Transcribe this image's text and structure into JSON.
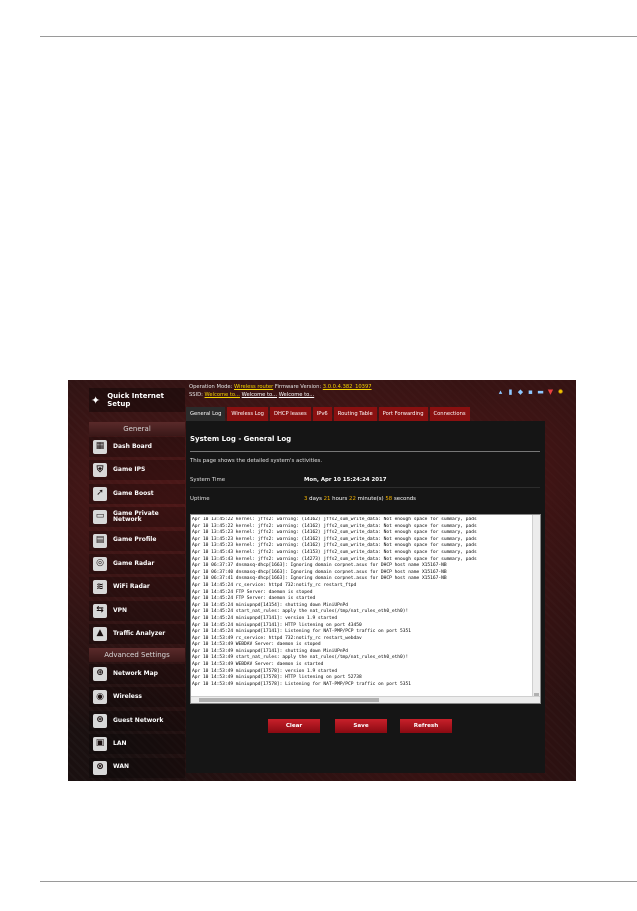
{
  "sidebar": {
    "quick_setup": "Quick Internet Setup",
    "general_heading": "General",
    "general_items": [
      {
        "label": "Dash Board",
        "icon": "dashboard-icon"
      },
      {
        "label": "Game IPS",
        "icon": "shield-icon"
      },
      {
        "label": "Game Boost",
        "icon": "rocket-icon"
      },
      {
        "label": "Game Private Network",
        "icon": "private-network-icon"
      },
      {
        "label": "Game Profile",
        "icon": "gamepad-icon"
      },
      {
        "label": "Game Radar",
        "icon": "radar-icon"
      },
      {
        "label": "WiFi Radar",
        "icon": "wifi-radar-icon"
      },
      {
        "label": "VPN",
        "icon": "vpn-icon"
      },
      {
        "label": "Traffic Analyzer",
        "icon": "traffic-analyzer-icon"
      }
    ],
    "advanced_heading": "Advanced Settings",
    "advanced_items": [
      {
        "label": "Network Map",
        "icon": "network-map-icon"
      },
      {
        "label": "Wireless",
        "icon": "wireless-icon"
      },
      {
        "label": "Guest Network",
        "icon": "guest-network-icon"
      },
      {
        "label": "LAN",
        "icon": "lan-icon"
      },
      {
        "label": "WAN",
        "icon": "wan-icon"
      }
    ]
  },
  "header": {
    "operation_mode_label": "Operation Mode:",
    "operation_mode_value": "Wireless router",
    "firmware_label": "Firmware Version:",
    "firmware_value": "3.0.0.4.382_10397",
    "ssid_label": "SSID:",
    "ssid_values": [
      "Welcome to...",
      "Welcome to...",
      "Welcome to..."
    ]
  },
  "tabs": [
    "General Log",
    "Wireless Log",
    "DHCP leases",
    "IPv6",
    "Routing Table",
    "Port Forwarding",
    "Connections"
  ],
  "panel": {
    "title": "System Log - General Log",
    "description": "This page shows the detailed system's activities.",
    "system_time_label": "System Time",
    "system_time_value": "Mon, Apr 10 15:24:24 2017",
    "uptime_label": "Uptime",
    "uptime_days": "3",
    "uptime_days_unit": " days ",
    "uptime_hours": "21",
    "uptime_hours_unit": " hours ",
    "uptime_minutes": "22",
    "uptime_minutes_unit": " minute(s) ",
    "uptime_seconds": "58",
    "uptime_seconds_unit": " seconds"
  },
  "log": [
    "Apr 10 13:45:22 kernel: jffs2: warning: (14162) jffs2_sum_write_data: Not enough space for summary, pads",
    "Apr 10 13:45:22 kernel: jffs2: warning: (14162) jffs2_sum_write_data: Not enough space for summary, pads",
    "Apr 10 13:45:23 kernel: jffs2: warning: (14162) jffs2_sum_write_data: Not enough space for summary, pads",
    "Apr 10 13:45:23 kernel: jffs2: warning: (14162) jffs2_sum_write_data: Not enough space for summary, pads",
    "Apr 10 13:45:23 kernel: jffs2: warning: (14162) jffs2_sum_write_data: Not enough space for summary, pads",
    "Apr 10 13:45:43 kernel: jffs2: warning: (14153) jffs2_sum_write_data: Not enough space for summary, pads",
    "Apr 10 13:45:43 kernel: jffs2: warning: (14273) jffs2_sum_write_data: Not enough space for summary, pads",
    "Apr 10 06:37:37 dnsmasq-dhcp[1663]: Ignoring domain corpnet.asus for DHCP host name X15167-NB",
    "Apr 10 06:37:40 dnsmasq-dhcp[1663]: Ignoring domain corpnet.asus for DHCP host name X15167-NB",
    "Apr 10 06:37:41 dnsmasq-dhcp[1663]: Ignoring domain corpnet.asus for DHCP host name X15167-NB",
    "Apr 10 14:45:24 rc_service: httpd 732:notify_rc restart_ftpd",
    "Apr 10 14:45:24 FTP Server: daemon is stoped",
    "Apr 10 14:45:24 FTP Server: daemon is started",
    "Apr 10 14:45:24 miniupnpd[14154]: shutting down MiniUPnPd",
    "Apr 10 14:45:24 start_nat_rules: apply the nat_rules(/tmp/nat_rules_eth0_eth0)!",
    "Apr 10 14:45:24 miniupnpd[17141]: version 1.9 started",
    "Apr 10 14:45:24 miniupnpd[17141]: HTTP listening on port 43450",
    "Apr 10 14:45:24 miniupnpd[17141]: Listening for NAT-PMP/PCP traffic on port 5351",
    "Apr 10 14:53:49 rc_service: httpd 732:notify_rc restart_webdav",
    "Apr 10 14:53:49 WEBDAV Server: daemon is stoped",
    "Apr 10 14:53:49 miniupnpd[17141]: shutting down MiniUPnPd",
    "Apr 10 14:53:49 start_nat_rules: apply the nat_rules(/tmp/nat_rules_eth0_eth0)!",
    "Apr 10 14:53:49 WEBDAV Server: daemon is started",
    "Apr 10 14:53:49 miniupnpd[17578]: version 1.9 started",
    "Apr 10 14:53:49 miniupnpd[17578]: HTTP listening on port 52738",
    "Apr 10 14:53:49 miniupnpd[17578]: Listening for NAT-PMP/PCP traffic on port 5351"
  ],
  "buttons": {
    "clear": "Clear",
    "save": "Save",
    "refresh": "Refresh"
  },
  "colors": {
    "accent_red": "#c8202a",
    "highlight_yellow": "#f5d400",
    "uptime_orange": "#f5b400"
  }
}
